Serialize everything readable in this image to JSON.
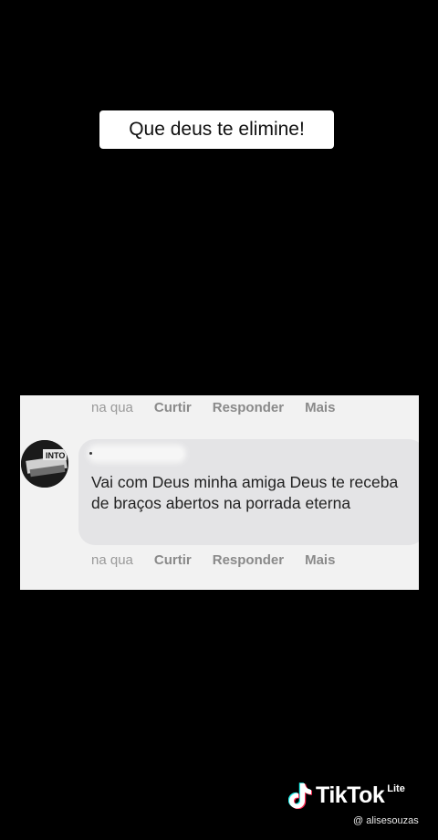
{
  "caption": "Que deus te elimine!",
  "comment": {
    "top_actions": {
      "time": "na qua",
      "like": "Curtir",
      "reply": "Responder",
      "more": "Mais"
    },
    "text": "Vai com Deus minha amiga Deus te receba de braços abertos na porrada eterna",
    "bottom_actions": {
      "time": "na qua",
      "like": "Curtir",
      "reply": "Responder",
      "more": "Mais"
    }
  },
  "watermark": {
    "brand": "TikTok",
    "edition": "Lite",
    "handle": "@ alisesouzas",
    "icon": "tiktok-note-icon"
  },
  "colors": {
    "background": "#000000",
    "panel": "#f2f2f2",
    "bubble": "#e4e4e6",
    "action_text": "#8a8a8a"
  }
}
